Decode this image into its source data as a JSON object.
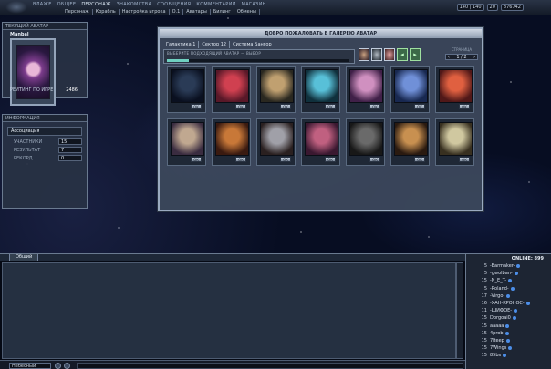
{
  "topbar": {
    "main_menu": [
      "ВЛАЖЕ",
      "ОБЩЕЕ",
      "ПЕРСОНАЖ",
      "ЗНАКОМСТВА",
      "СООБЩЕНИЯ",
      "КОММЕНТАРИИ",
      "МАГАЗИН"
    ],
    "main_menu_active": "ПЕРСОНАЖ",
    "sub_menu": [
      "Персонаж",
      "Корабль",
      "Настройка игрока",
      "О.1",
      "Аватары",
      "Билинг",
      "Обмены"
    ],
    "stats": {
      "health": "140 | 140",
      "level": "20",
      "money": "876742"
    }
  },
  "avatar_panel": {
    "title": "ТЕКУЩИЙ АВАТАР",
    "player_name": "Manbal",
    "rating_label": "РЕЙТИНГ ПО ИГРЕ",
    "rating_value": "2486"
  },
  "stats_panel": {
    "title": "ИНФОРМАЦИЯ",
    "header": "Ассоциация",
    "rows": [
      {
        "label": "УЧАСТНИКИ",
        "value": "15"
      },
      {
        "label": "РЕЗУЛЬТАТ",
        "value": "7"
      },
      {
        "label": "РЕКОРД",
        "value": "0"
      }
    ]
  },
  "gallery": {
    "title": "ДОБРО ПОЖАЛОВАТЬ В ГАЛЕРЕЮ АВАТАР",
    "tabs": [
      "Галактика 1",
      "Сектор 12",
      "Система Бангор"
    ],
    "sub_label": "ВЫБЕРИТЕ ПОДХОДЯЩИЙ АВАТАР — ВЫБОР",
    "progress": 0.12,
    "page_label": "СТРАНИЦА",
    "page_value": "1 / 2",
    "ok_label": "OK",
    "avatars": [
      {
        "colors": [
          "#2a3b56",
          "#0a1020"
        ]
      },
      {
        "colors": [
          "#d04050",
          "#581828"
        ]
      },
      {
        "colors": [
          "#c0a070",
          "#2a2820"
        ]
      },
      {
        "colors": [
          "#58c0d8",
          "#10303c"
        ]
      },
      {
        "colors": [
          "#d090c0",
          "#402048"
        ]
      },
      {
        "colors": [
          "#7090d8",
          "#182850"
        ]
      },
      {
        "colors": [
          "#e06040",
          "#501818"
        ]
      },
      {
        "colors": [
          "#c0a890",
          "#3a2c40"
        ]
      },
      {
        "colors": [
          "#c87838",
          "#3a1a10"
        ]
      },
      {
        "colors": [
          "#a0a0a8",
          "#2a2020"
        ]
      },
      {
        "colors": [
          "#c06080",
          "#3a1830"
        ]
      },
      {
        "colors": [
          "#6a6a6a",
          "#181818"
        ]
      },
      {
        "colors": [
          "#c89050",
          "#2a1a10"
        ]
      },
      {
        "colors": [
          "#d0c8a0",
          "#383020"
        ]
      }
    ]
  },
  "chat": {
    "tab_label": "Общий",
    "channel": "Небесный",
    "online_label": "ONLINE: 899",
    "users": [
      {
        "level": "5",
        "name": "-Barmaker-"
      },
      {
        "level": "5",
        "name": "-gwolban-"
      },
      {
        "level": "15",
        "name": "-N_E_T-"
      },
      {
        "level": "5",
        "name": "-Roland-"
      },
      {
        "level": "17",
        "name": "-Virgo-"
      },
      {
        "level": "16",
        "name": "-ХАН-КРОНОС-"
      },
      {
        "level": "11",
        "name": "-ШИФОЕ-"
      },
      {
        "level": "15",
        "name": "Dbrgoai0"
      },
      {
        "level": "15",
        "name": "aaaaa"
      },
      {
        "level": "15",
        "name": "4prob"
      },
      {
        "level": "15",
        "name": "7lteep"
      },
      {
        "level": "15",
        "name": "7Wings"
      },
      {
        "level": "15",
        "name": "85bs"
      }
    ]
  }
}
